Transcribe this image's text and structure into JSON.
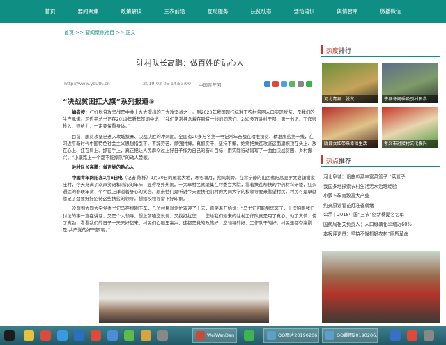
{
  "nav": {
    "items": [
      "首页",
      "要闻聚焦",
      "政策解读",
      "三农前沿",
      "互动服务",
      "扶贫动态",
      "活动培训",
      "舆情智库",
      "微播微信"
    ]
  },
  "breadcrumb": {
    "text": "首页 >> 要闻聚焦社目 >> 正文"
  },
  "article": {
    "title": "驻村队长高鹏：做百姓的贴心人",
    "url": "http://www.youth.cn",
    "date": "2019-02-05 14:53:00",
    "source": "中国青年网",
    "subtitle": "“决战贫困扛大旗”系列报道⑤",
    "paragraphs": [
      {
        "bold": "编者按：",
        "text": "打好脱贫攻坚战是中共十九大提出的三大攻坚战之一。到2020年我国现行标准下农村贫困人口实现脱贫，是我们的生产承诺。习近平总书记在2019年新年贺词中说：“我们常常挂念着在脱贫一线的同志们，280多万驻村干部、第一书记，工作很投入、很给力，一定要保重身体。”"
      },
      {
        "bold": "",
        "text": "目前，脱贫攻坚已进入攻城拔寨、决战决胜的冲刺期。全国有20多万名第一书记常年奋战在精准扶贫、精准脱贫第一线，在习近平新时代中国特色社会主义思想指引下，不辞劳苦、顽强拼搏，真抓实干、坚持不懈，始终把扶贫攻坚这面旗帜顶在头上、放在心上、扛在肩上、抓在手上，真正把让人民群众过上好日子作为自己的奋斗目标，用实际行动谱写了一曲曲决战贫困，乡村振兴，“小康路上一个都不能掉队”的动人赞歌。"
      },
      {
        "bold": "驻村队长高鹏：做百姓的贴心人",
        "text": ""
      },
      {
        "bold": "中国青年网阳高2月5日电",
        "text": "（记者 陈栎）1月30日的雁北大地，寒冬凛月，朔风刺骨。在常宁静的山西省阳高县罗文皂镇谢家庄村，今天充满了欢声笑语和浓浓的年味，显得格外热闹。一大早村民就聚集在村委会大院，看着扶贫帮扶的中药材科研楼，红火通达的春联年货，个个脸上洋溢着舒心的笑容。原来他们是听说今天要扶他们村的大同大学的校领导要来看望村民，村民可是早就憋足了劲要好好招待这些扶贫的领导，想给校领导留下好印象。"
      },
      {
        "bold": "",
        "text": "没想到大同大学党委书记马存根刚下车，几位村民就急忙欢迎了上去，直笑着开始说：“马书记可盼到您来了，上次咱跟我们讨论的事一直在讲话，又是个大领导，想上前咱您说说，又找打扰您……您给我们派来的驻村工作队真是用了真心、动了真情、使了真劲，看看我们的日子一天天好起来，村民们心眼里高兴，这都是党的政策好、您领导的好、工作队干的好。村民还都夸高鹏是‘共产党的好干部’呢。”"
      }
    ]
  },
  "sidebar": {
    "hot_rank_title": "热度",
    "hot_rank_title_suffix": "排行",
    "thumbs": [
      {
        "caption": "河北青县：脱贫"
      },
      {
        "caption": "宁县冬闲季吸引村民参"
      },
      {
        "caption": "陇县女红带来幸福生活"
      },
      {
        "caption": "孝义市对接村文化振兴"
      }
    ],
    "recommend_title": "热点",
    "recommend_title_suffix": "推荐",
    "recommend_items": [
      "河北阜城：设施瓜菜丰富菜篮子 “莱篮子",
      "我国多地探索农村生活污水治理经验",
      "小萝卜孕育致富大产业",
      "约夹原谅春花灯准备就绪",
      "公示｜2018中国“三农”创新榜提名名单",
      "国病局相关负责人：人口级磷化率增近60%",
      "本报评论员：坚持不懈抓好农村“厕所革命"
    ]
  },
  "taskbar": {
    "tasks": [
      {
        "label": "WeiWanDan"
      },
      {
        "label": "QQ图片20190206..."
      },
      {
        "label": "QQ截图20190206..."
      }
    ]
  },
  "colors": {
    "nav": "#0f8f83",
    "accent": "#c53b2a"
  }
}
